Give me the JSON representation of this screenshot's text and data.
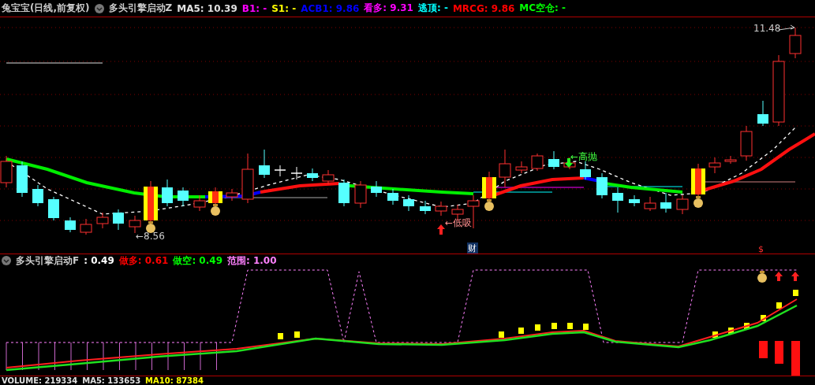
{
  "main_panel": {
    "title": "兔宝宝(日线,前复权)",
    "indicator": "多头引擎启动Z",
    "readouts": [
      {
        "text": "MA5: 10.39",
        "color": "#e0e0e0"
      },
      {
        "text": "B1: -",
        "color": "#ff00ff"
      },
      {
        "text": "S1: -",
        "color": "#ffff00"
      },
      {
        "text": "ACB1: 9.86",
        "color": "#0000ff"
      },
      {
        "text": "看多: 9.31",
        "color": "#ff00ff"
      },
      {
        "text": "逃顶: -",
        "color": "#00ffff"
      },
      {
        "text": "MRCG: 9.86",
        "color": "#ff0000"
      },
      {
        "text": "MC空仓: -",
        "color": "#00ff00"
      }
    ],
    "high_label": "11.48",
    "low_label": "←8.56",
    "buy_label": "←低吸",
    "sell_label": "←高抛",
    "badge": "财",
    "dollar_mark": "$"
  },
  "sub_panel": {
    "indicator": "多头引擎启动F",
    "value": ": 0.49",
    "readouts": [
      {
        "text": "做多: 0.61",
        "color": "#ff0000"
      },
      {
        "text": "做空: 0.49",
        "color": "#00ff00"
      },
      {
        "text": "范围: 1.00",
        "color": "#ff80ff"
      }
    ]
  },
  "volume_panel": {
    "readouts": [
      {
        "text": "VOLUME: 219334",
        "color": "#e0e0e0"
      },
      {
        "text": "MA5: 133653",
        "color": "#e0e0e0"
      },
      {
        "text": "MA10: 87384",
        "color": "#ffff00"
      }
    ]
  }
}
